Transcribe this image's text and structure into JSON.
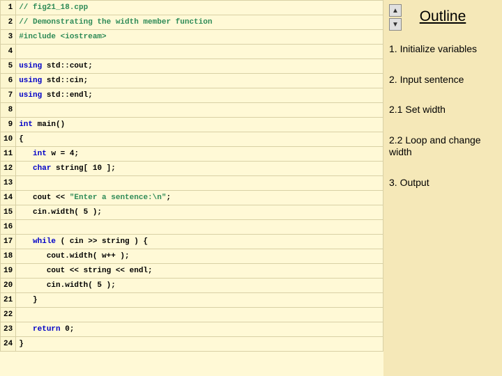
{
  "code": {
    "lines": [
      {
        "n": "1",
        "html": "<span class='comment'>// fig21_18.cpp</span>"
      },
      {
        "n": "2",
        "html": "<span class='comment'>// Demonstrating the width member function</span>"
      },
      {
        "n": "3",
        "html": "<span class='preproc'>#include</span> <span class='preproc'>&lt;iostream&gt;</span>"
      },
      {
        "n": "4",
        "html": ""
      },
      {
        "n": "5",
        "html": "<span class='kw'>using</span> <span class='plain'>std::cout;</span>"
      },
      {
        "n": "6",
        "html": "<span class='kw'>using</span> <span class='plain'>std::cin;</span>"
      },
      {
        "n": "7",
        "html": "<span class='kw'>using</span> <span class='plain'>std::endl;</span>"
      },
      {
        "n": "8",
        "html": ""
      },
      {
        "n": "9",
        "html": "<span class='kw'>int</span> <span class='plain'>main()</span>"
      },
      {
        "n": "10",
        "html": "<span class='plain'>{</span>"
      },
      {
        "n": "11",
        "html": "   <span class='kw'>int</span> <span class='plain'>w = 4;</span>"
      },
      {
        "n": "12",
        "html": "   <span class='kw'>char</span> <span class='plain'>string[ 10 ];</span>"
      },
      {
        "n": "13",
        "html": ""
      },
      {
        "n": "14",
        "html": "   <span class='plain'>cout &lt;&lt; </span><span class='str'>\"Enter a sentence:\\n\"</span><span class='plain'>;</span>"
      },
      {
        "n": "15",
        "html": "   <span class='plain'>cin.width( 5 );</span>"
      },
      {
        "n": "16",
        "html": ""
      },
      {
        "n": "17",
        "html": "   <span class='kw'>while</span> <span class='plain'>( cin &gt;&gt; string ) {</span>"
      },
      {
        "n": "18",
        "html": "      <span class='plain'>cout.width( w++ );</span>"
      },
      {
        "n": "19",
        "html": "      <span class='plain'>cout &lt;&lt; string &lt;&lt; endl;</span>"
      },
      {
        "n": "20",
        "html": "      <span class='plain'>cin.width( 5 );</span>"
      },
      {
        "n": "21",
        "html": "   <span class='plain'>}</span>"
      },
      {
        "n": "22",
        "html": ""
      },
      {
        "n": "23",
        "html": "   <span class='kw'>return</span> <span class='plain'>0;</span>"
      },
      {
        "n": "24",
        "html": "<span class='plain'>}</span>"
      }
    ]
  },
  "outline": {
    "title": "Outline",
    "items": [
      "1. Initialize variables",
      "2. Input sentence",
      "2.1 Set width",
      "2.2 Loop and change width",
      "3. Output"
    ]
  },
  "nav": {
    "up": "▲",
    "down": "▼"
  }
}
